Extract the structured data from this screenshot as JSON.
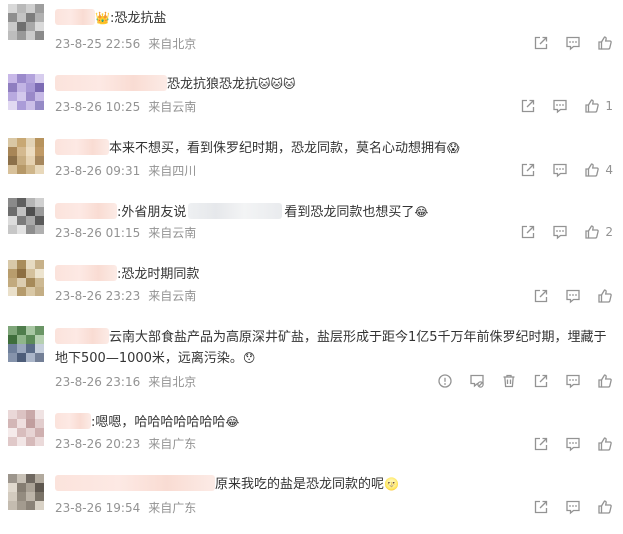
{
  "comments": [
    {
      "text": ":恐龙抗盐",
      "emoji_after": "",
      "lead_emoji": "👑",
      "time": "23-8-25 22:56",
      "location": "来自北京",
      "likes": ""
    },
    {
      "text": "恐龙抗狼恐龙抗",
      "emoji_after": "🐱🐱🐱",
      "time": "23-8-26 10:25",
      "location": "来自云南",
      "likes": "1"
    },
    {
      "text": "本来不想买，看到侏罗纪时期，恐龙同款，莫名心动想拥有",
      "emoji_after": "😱",
      "time": "23-8-26 09:31",
      "location": "来自四川",
      "likes": "4"
    },
    {
      "text_a": ":外省朋友说",
      "text_b": "看到恐龙同款也想买了",
      "emoji_after": "😂",
      "time": "23-8-26 01:15",
      "location": "来自云南",
      "likes": "2"
    },
    {
      "text": ":恐龙时期同款",
      "emoji_after": "",
      "time": "23-8-26 23:23",
      "location": "来自云南",
      "likes": ""
    },
    {
      "text": "云南大部食盐产品为高原深井矿盐，盐层形成于距今1亿5千万年前侏罗纪时期，埋藏于地下500—1000米，远离污染。",
      "emoji_after": "😯",
      "time": "23-8-26 23:16",
      "location": "来自北京",
      "likes": ""
    },
    {
      "text": ":嗯嗯，哈哈哈哈哈哈哈",
      "emoji_after": "😂",
      "time": "23-8-26 20:23",
      "location": "来自广东",
      "likes": ""
    },
    {
      "text": "原来我吃的盐是恐龙同款的呢",
      "emoji_after": "🌝",
      "time": "23-8-26 19:54",
      "location": "来自广东",
      "likes": ""
    }
  ],
  "icons": {
    "share": "share-icon",
    "comment": "comment-icon",
    "like": "thumbs-up-icon",
    "report": "report-icon",
    "block": "block-icon",
    "delete": "delete-icon"
  },
  "colors": {
    "text": "#333333",
    "meta": "#939393",
    "blur_pink": "#fbe3dc"
  }
}
